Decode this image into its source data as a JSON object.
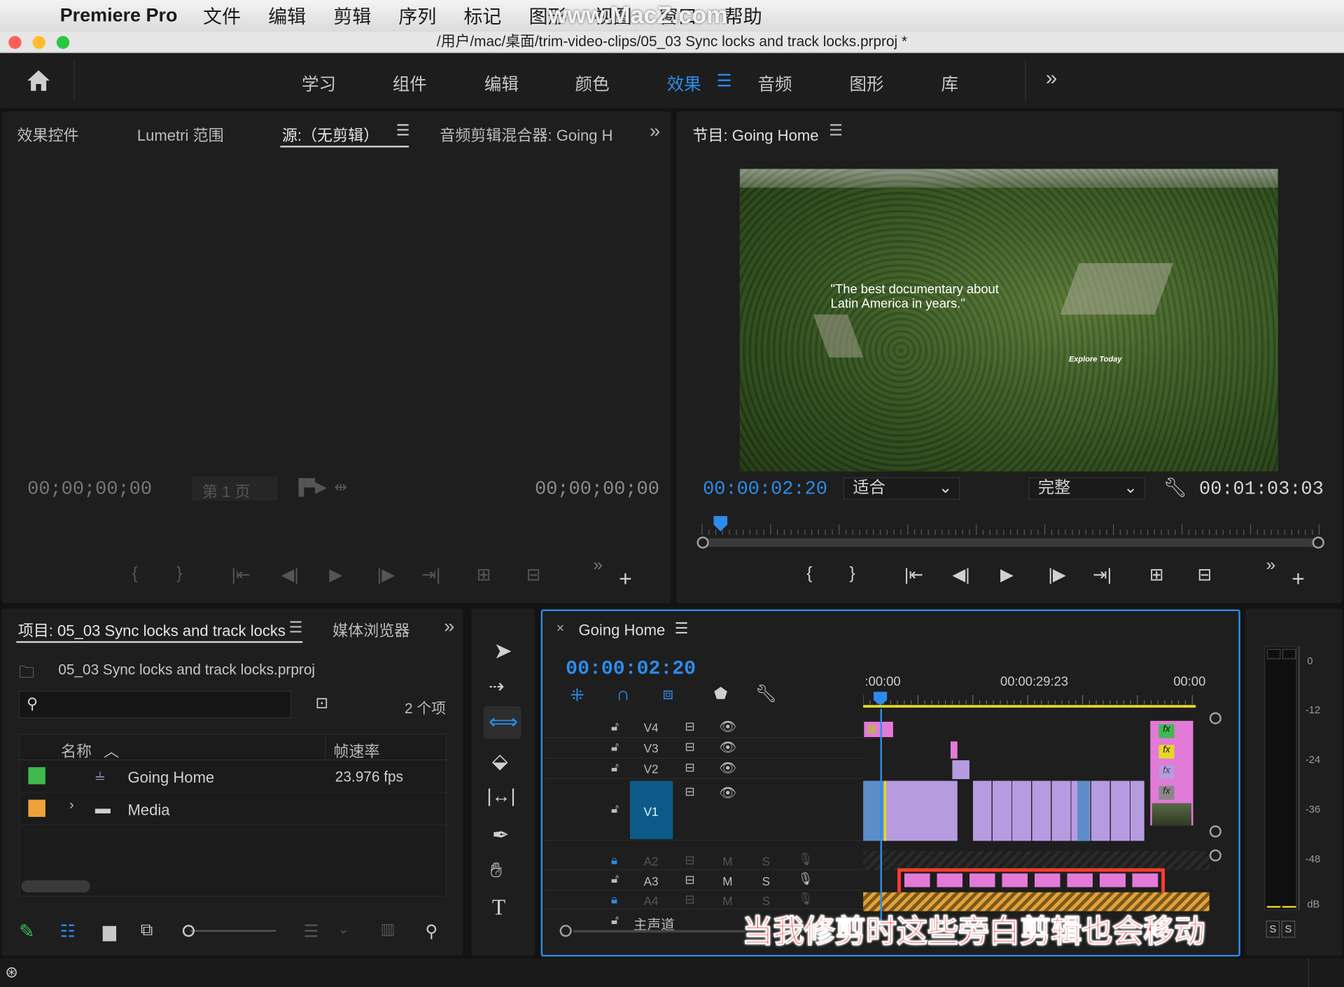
{
  "menubar": {
    "app_name": "Premiere Pro",
    "items": [
      "文件",
      "编辑",
      "剪辑",
      "序列",
      "标记",
      "图形",
      "视图",
      "窗口",
      "帮助"
    ],
    "watermark": "www.MacZ.com"
  },
  "titlebar": {
    "path": "/用户/mac/桌面/trim-video-clips/05_03 Sync locks and track locks.prproj *"
  },
  "workspaces": {
    "items": [
      "学习",
      "组件",
      "编辑",
      "颜色",
      "效果",
      "音频",
      "图形",
      "库"
    ],
    "active": "效果",
    "more": "»"
  },
  "source_panel": {
    "tabs": [
      "效果控件",
      "Lumetri 范围",
      "源:（无剪辑）",
      "音频剪辑混合器: Going H"
    ],
    "timecode_left": "00;00;00;00",
    "page_label": "第 1 页",
    "timecode_right": "00;00;00;00"
  },
  "program_panel": {
    "title": "节目: Going Home",
    "overlay_quote": "\"The best documentary about Latin America in years.\"",
    "overlay_brand": "Explore Today",
    "timecode": "00:00:02:20",
    "fit_select": "适合",
    "quality_select": "完整",
    "duration": "00:01:03:03",
    "playhead_fraction": 0.03
  },
  "project_panel": {
    "tab_project": "项目: 05_03 Sync locks and track locks",
    "tab_media": "媒体浏览器",
    "file_name": "05_03 Sync locks and track locks.prproj",
    "item_count": "2 个项",
    "col_name": "名称",
    "col_fps": "帧速率",
    "rows": [
      {
        "name": "Going Home",
        "fps": "23.976 fps",
        "color": "#3fb950"
      },
      {
        "name": "Media",
        "fps": "",
        "color": "#f0a23a"
      }
    ]
  },
  "timeline": {
    "sequence_name": "Going Home",
    "timecode": "00:00:02:20",
    "ruler": [
      ":00:00",
      "00:00:29:23",
      "00:00"
    ],
    "video_tracks": [
      "V4",
      "V3",
      "V2",
      "V1"
    ],
    "audio_tracks": [
      "A2",
      "A3",
      "A4"
    ],
    "master_label": "主声道",
    "mute_label": "M",
    "solo_label": "S",
    "fx_label": "fx"
  },
  "meter": {
    "scale": [
      "0",
      "-12",
      "-24",
      "-36",
      "-48",
      "dB"
    ],
    "solo_buttons": [
      "S",
      "S"
    ]
  },
  "caption": "当我修剪时这些旁白剪辑也会移动",
  "colors": {
    "accent_blue": "#2d8ceb",
    "caption_red": "#ff2d2d",
    "clip_purple": "#b69be0",
    "clip_pink": "#e27ad8",
    "audio_orange": "#e4a13a"
  }
}
